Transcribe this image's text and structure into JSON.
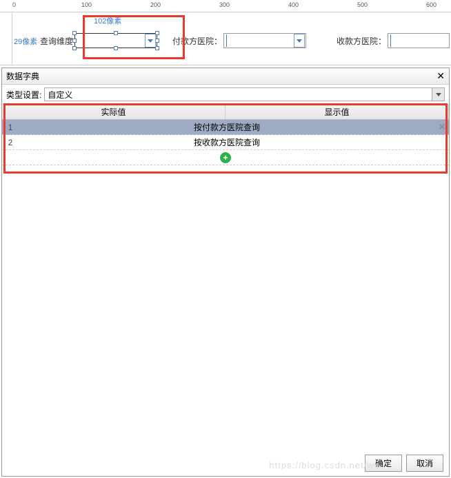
{
  "ruler": {
    "marks": [
      "0",
      "100",
      "200",
      "300",
      "400",
      "500",
      "600"
    ]
  },
  "pixelLabels": {
    "vert": "29像素",
    "horiz": "102像素"
  },
  "fields": {
    "queryDim": {
      "label": "查询维度"
    },
    "payHosp": {
      "label": "付款方医院："
    },
    "recvHosp": {
      "label": "收款方医院："
    }
  },
  "dialog": {
    "title": "数据字典",
    "typeLabel": "类型设置:",
    "typeValue": "自定义",
    "headers": {
      "actual": "实际值",
      "display": "显示值"
    },
    "rows": [
      {
        "num": "1",
        "value": "按付款方医院查询"
      },
      {
        "num": "2",
        "value": "按收款方医院查询"
      }
    ],
    "buttons": {
      "ok": "确定",
      "cancel": "取消"
    }
  },
  "watermark": "https://blog.csdn.net/we"
}
